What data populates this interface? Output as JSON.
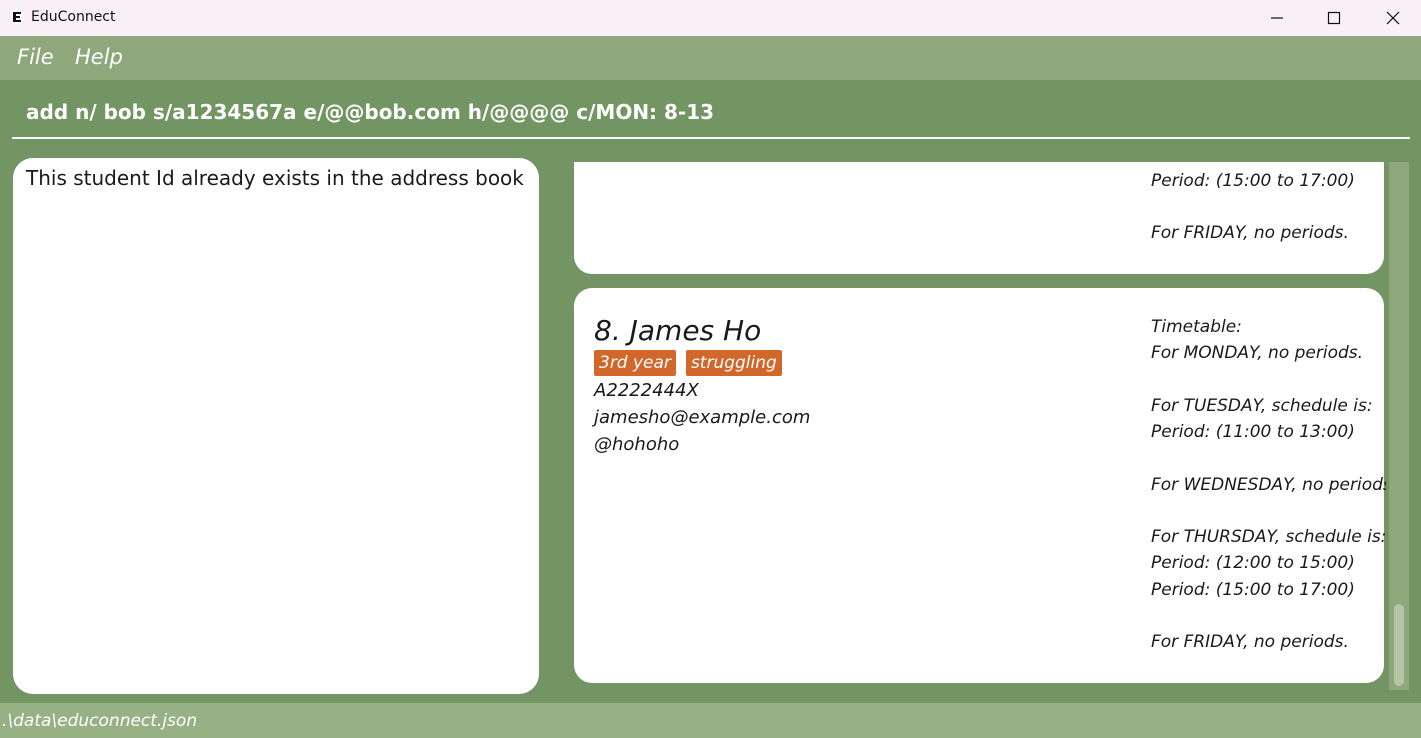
{
  "window": {
    "title": "EduConnect",
    "icon": "educonnect-logo-icon",
    "controls": {
      "minimize": "minimize-icon",
      "maximize": "maximize-icon",
      "close": "close-icon"
    }
  },
  "menu": {
    "file": "File",
    "help": "Help"
  },
  "command": {
    "value": "add n/ bob s/a1234567a e/@@bob.com h/@@@@ c/MON: 8-13"
  },
  "result": {
    "message": "This student Id already exists in the address book"
  },
  "list": {
    "previous_card": {
      "lines": [
        "Period: (15:00 to 17:00)",
        "For FRIDAY, no periods."
      ]
    },
    "card": {
      "index": "8.",
      "name": "James Ho",
      "tags": [
        "3rd year",
        "struggling"
      ],
      "student_id": "A2222444X",
      "email": "jamesho@example.com",
      "telegram": "@hohoho",
      "timetable": {
        "header": "Timetable:",
        "monday": "For MONDAY, no periods.",
        "tuesday": "For TUESDAY, schedule is:",
        "tuesday_p1": "Period: (11:00 to 13:00)",
        "wednesday": "For WEDNESDAY, no periods.",
        "thursday": "For THURSDAY, schedule is:",
        "thursday_p1": "Period: (12:00 to 15:00)",
        "thursday_p2": "Period: (15:00 to 17:00)",
        "friday": "For FRIDAY, no periods."
      }
    }
  },
  "status": {
    "path": ".\\data\\educonnect.json"
  },
  "colors": {
    "menubar": "#8ea77b",
    "background": "#739563",
    "tag": "#d2672c",
    "statusbar": "#97b084"
  }
}
